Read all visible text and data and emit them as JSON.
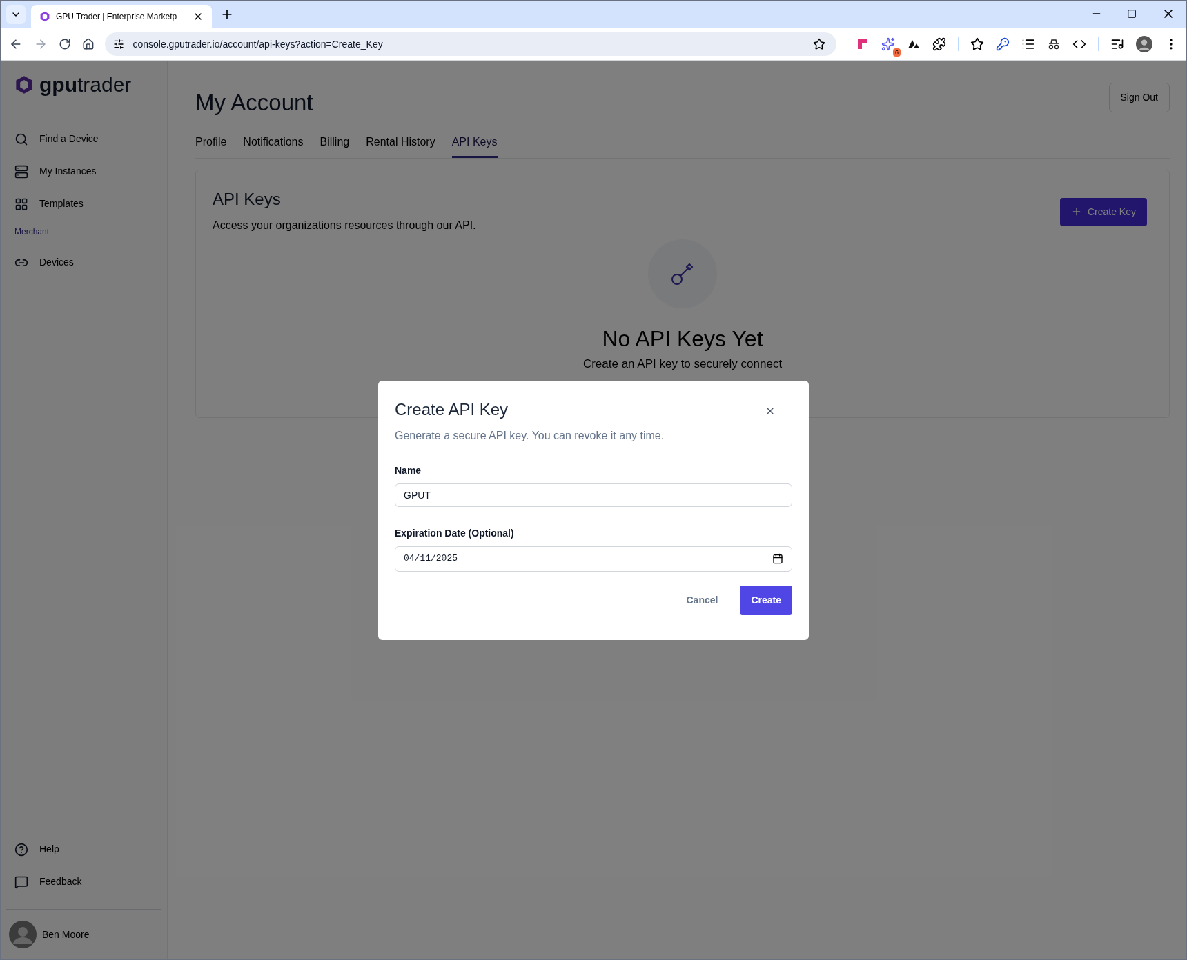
{
  "browser": {
    "tab_title": "GPU Trader | Enterprise Marketp",
    "url": "console.gputrader.io/account/api-keys?action=Create_Key",
    "extension_badge": "6"
  },
  "sidebar": {
    "brand": {
      "bold": "gpu",
      "light": "trader"
    },
    "items": [
      {
        "label": "Find a Device"
      },
      {
        "label": "My Instances"
      },
      {
        "label": "Templates"
      }
    ],
    "section_label": "Merchant",
    "merchant_items": [
      {
        "label": "Devices"
      }
    ],
    "footer_items": [
      {
        "label": "Help"
      },
      {
        "label": "Feedback"
      }
    ],
    "user": {
      "name": "Ben Moore"
    }
  },
  "page": {
    "title": "My Account",
    "sign_out": "Sign Out",
    "tabs": [
      {
        "label": "Profile",
        "selected": false
      },
      {
        "label": "Notifications",
        "selected": false
      },
      {
        "label": "Billing",
        "selected": false
      },
      {
        "label": "Rental History",
        "selected": false
      },
      {
        "label": "API Keys",
        "selected": true
      }
    ],
    "card": {
      "title": "API Keys",
      "description": "Access your organizations resources through our API.",
      "create_button": "Create Key",
      "empty_title": "No API Keys Yet",
      "empty_text": "Create an API key to securely connect"
    }
  },
  "dialog": {
    "title": "Create API Key",
    "description": "Generate a secure API key. You can revoke it any time.",
    "fields": [
      {
        "kind": "text",
        "label": "Name",
        "value": "GPUT"
      },
      {
        "kind": "date",
        "label": "Expiration Date (Optional)",
        "value": "04/11/2025"
      }
    ],
    "cancel": "Cancel",
    "submit": "Create"
  }
}
